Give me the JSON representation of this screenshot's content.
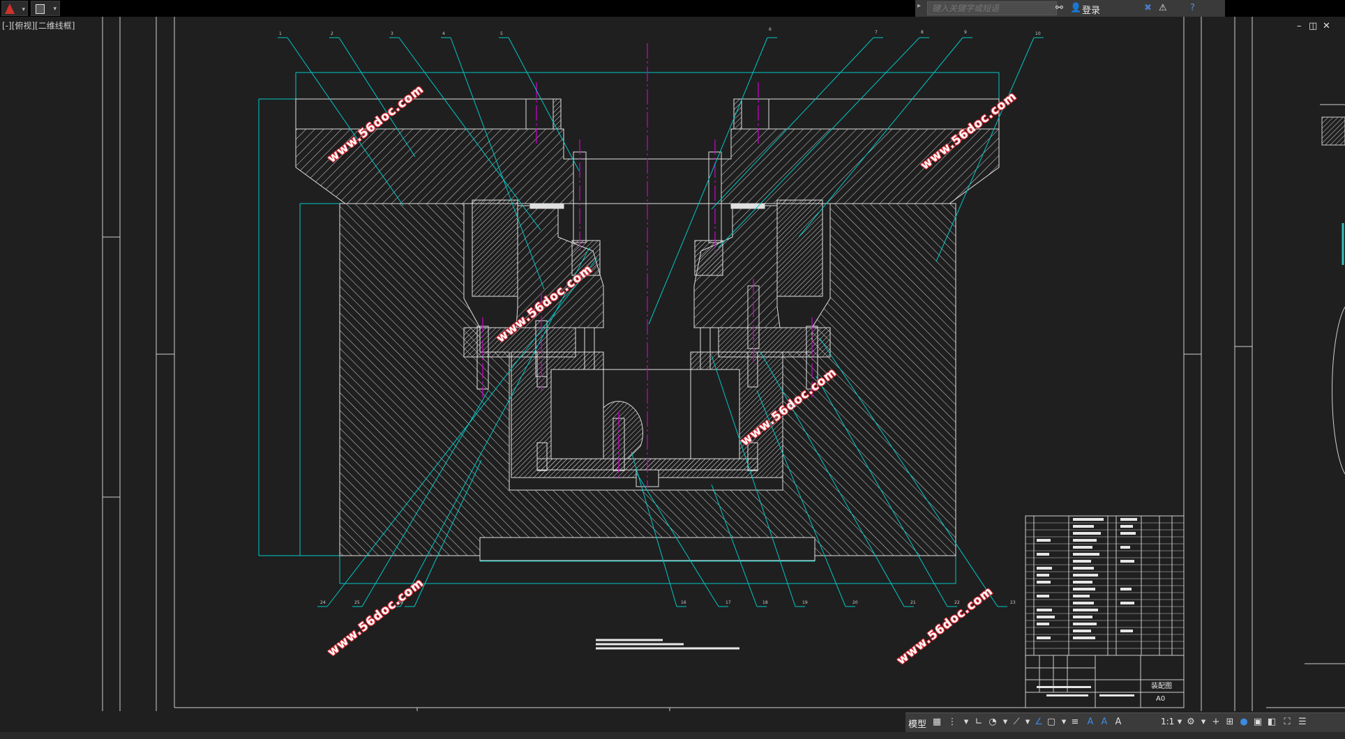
{
  "app": {
    "logo_icon": "autocad-logo-icon",
    "qa_icon": "quick-access-icon"
  },
  "search": {
    "placeholder": "键入关键字或短语"
  },
  "account": {
    "login_label": "登录"
  },
  "viewport": {
    "label": "[-][俯视][二维线框]"
  },
  "window_controls": {
    "minimize": "–",
    "restore": "◫",
    "close": "✕"
  },
  "watermark": {
    "text": "www.56doc.com"
  },
  "title_block": {
    "drawing_title": "装配图",
    "sheet_size": "A0"
  },
  "status_bar": {
    "model_label": "模型",
    "scale_label": "1:1"
  },
  "colors": {
    "background": "#1f1f1f",
    "outline": "#ffffff",
    "leader": "#00c8c8",
    "centerline": "#d000d0",
    "brand_red": "#d0312d",
    "accent_blue": "#3c8be0"
  },
  "balloons": [
    "1",
    "2",
    "3",
    "4",
    "5",
    "6",
    "7",
    "8",
    "9",
    "10",
    "16",
    "17",
    "18",
    "19",
    "20",
    "21",
    "22",
    "23",
    "24",
    "25",
    "26"
  ]
}
